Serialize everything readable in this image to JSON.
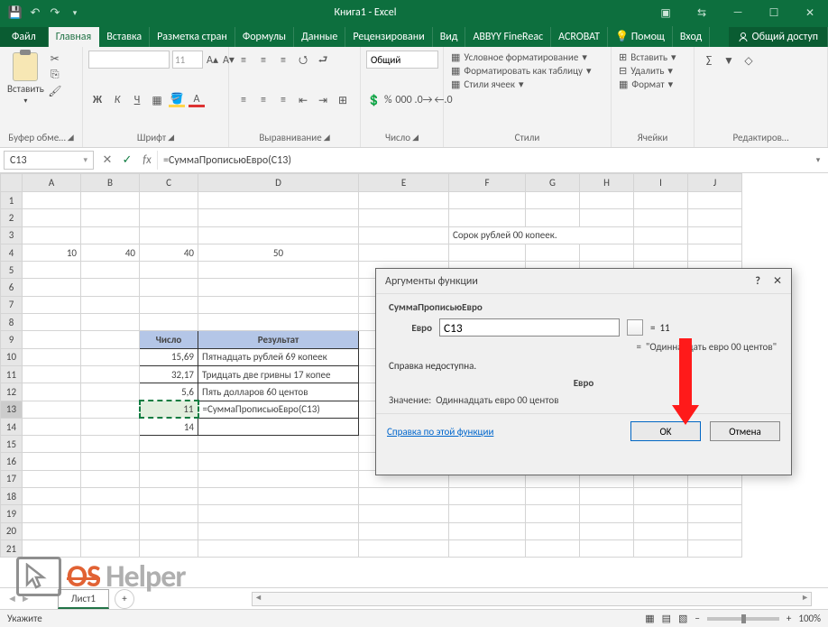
{
  "title": "Книга1 - Excel",
  "tabs": {
    "file": "Файл",
    "home": "Главная",
    "insert": "Вставка",
    "layout": "Разметка стран",
    "formulas": "Формулы",
    "data": "Данные",
    "review": "Рецензировани",
    "view": "Вид",
    "abbyy": "ABBYY FineReaс",
    "acrobat": "ACROBAT",
    "help": "Помощ",
    "login": "Вход",
    "share": "Общий доступ"
  },
  "ribbon": {
    "paste": "Вставить",
    "clipboard": "Буфер обме…",
    "font_group": "Шрифт",
    "font_size": "11",
    "align_group": "Выравнивание",
    "number_group": "Число",
    "number_format": "Общий",
    "styles_group": "Стили",
    "cond": "Условное форматирование",
    "table": "Форматировать как таблицу",
    "cell_styles": "Стили ячеек",
    "cells_group": "Ячейки",
    "insert_c": "Вставить",
    "delete_c": "Удалить",
    "format_c": "Формат",
    "edit_group": "Редактиров…"
  },
  "fbar": {
    "ref": "C13",
    "formula": "=СуммаПрописьюЕвро(C13)"
  },
  "columns": [
    "A",
    "B",
    "C",
    "D",
    "E",
    "F",
    "G",
    "H",
    "I",
    "J"
  ],
  "cells": {
    "row3_result": "Сорок рублей  00 копеек.",
    "r4": {
      "A": "10",
      "B": "40",
      "C": "40",
      "D": "50"
    },
    "headers": {
      "number": "Число",
      "result": "Результат"
    },
    "table": [
      {
        "num": "15,69",
        "res": "Пятнадцать рублей 69 копеек"
      },
      {
        "num": "32,17",
        "res": "Тридцать две гривны 17 копее"
      },
      {
        "num": "5,6",
        "res": "Пять долларов 60 центов"
      },
      {
        "num": "11",
        "res": "=СуммаПрописьюЕвро(C13)"
      },
      {
        "num": "14",
        "res": ""
      }
    ]
  },
  "dialog": {
    "title": "Аргументы функции",
    "fn": "СуммаПрописьюЕвро",
    "arg_label": "Евро",
    "arg_value": "C13",
    "eq_val": "11",
    "eq_text": "\"Одиннадцать евро 00 центов\"",
    "no_help": "Справка недоступна.",
    "arg_name": "Евро",
    "value_label": "Значение:",
    "value": "Одиннадцать евро 00 центов",
    "link": "Справка по этой функции",
    "ok": "OK",
    "cancel": "Отмена"
  },
  "sheet": "Лист1",
  "status": "Укажите",
  "zoom": "100%",
  "watermark": {
    "os": "OS",
    "helper": "Helper"
  }
}
